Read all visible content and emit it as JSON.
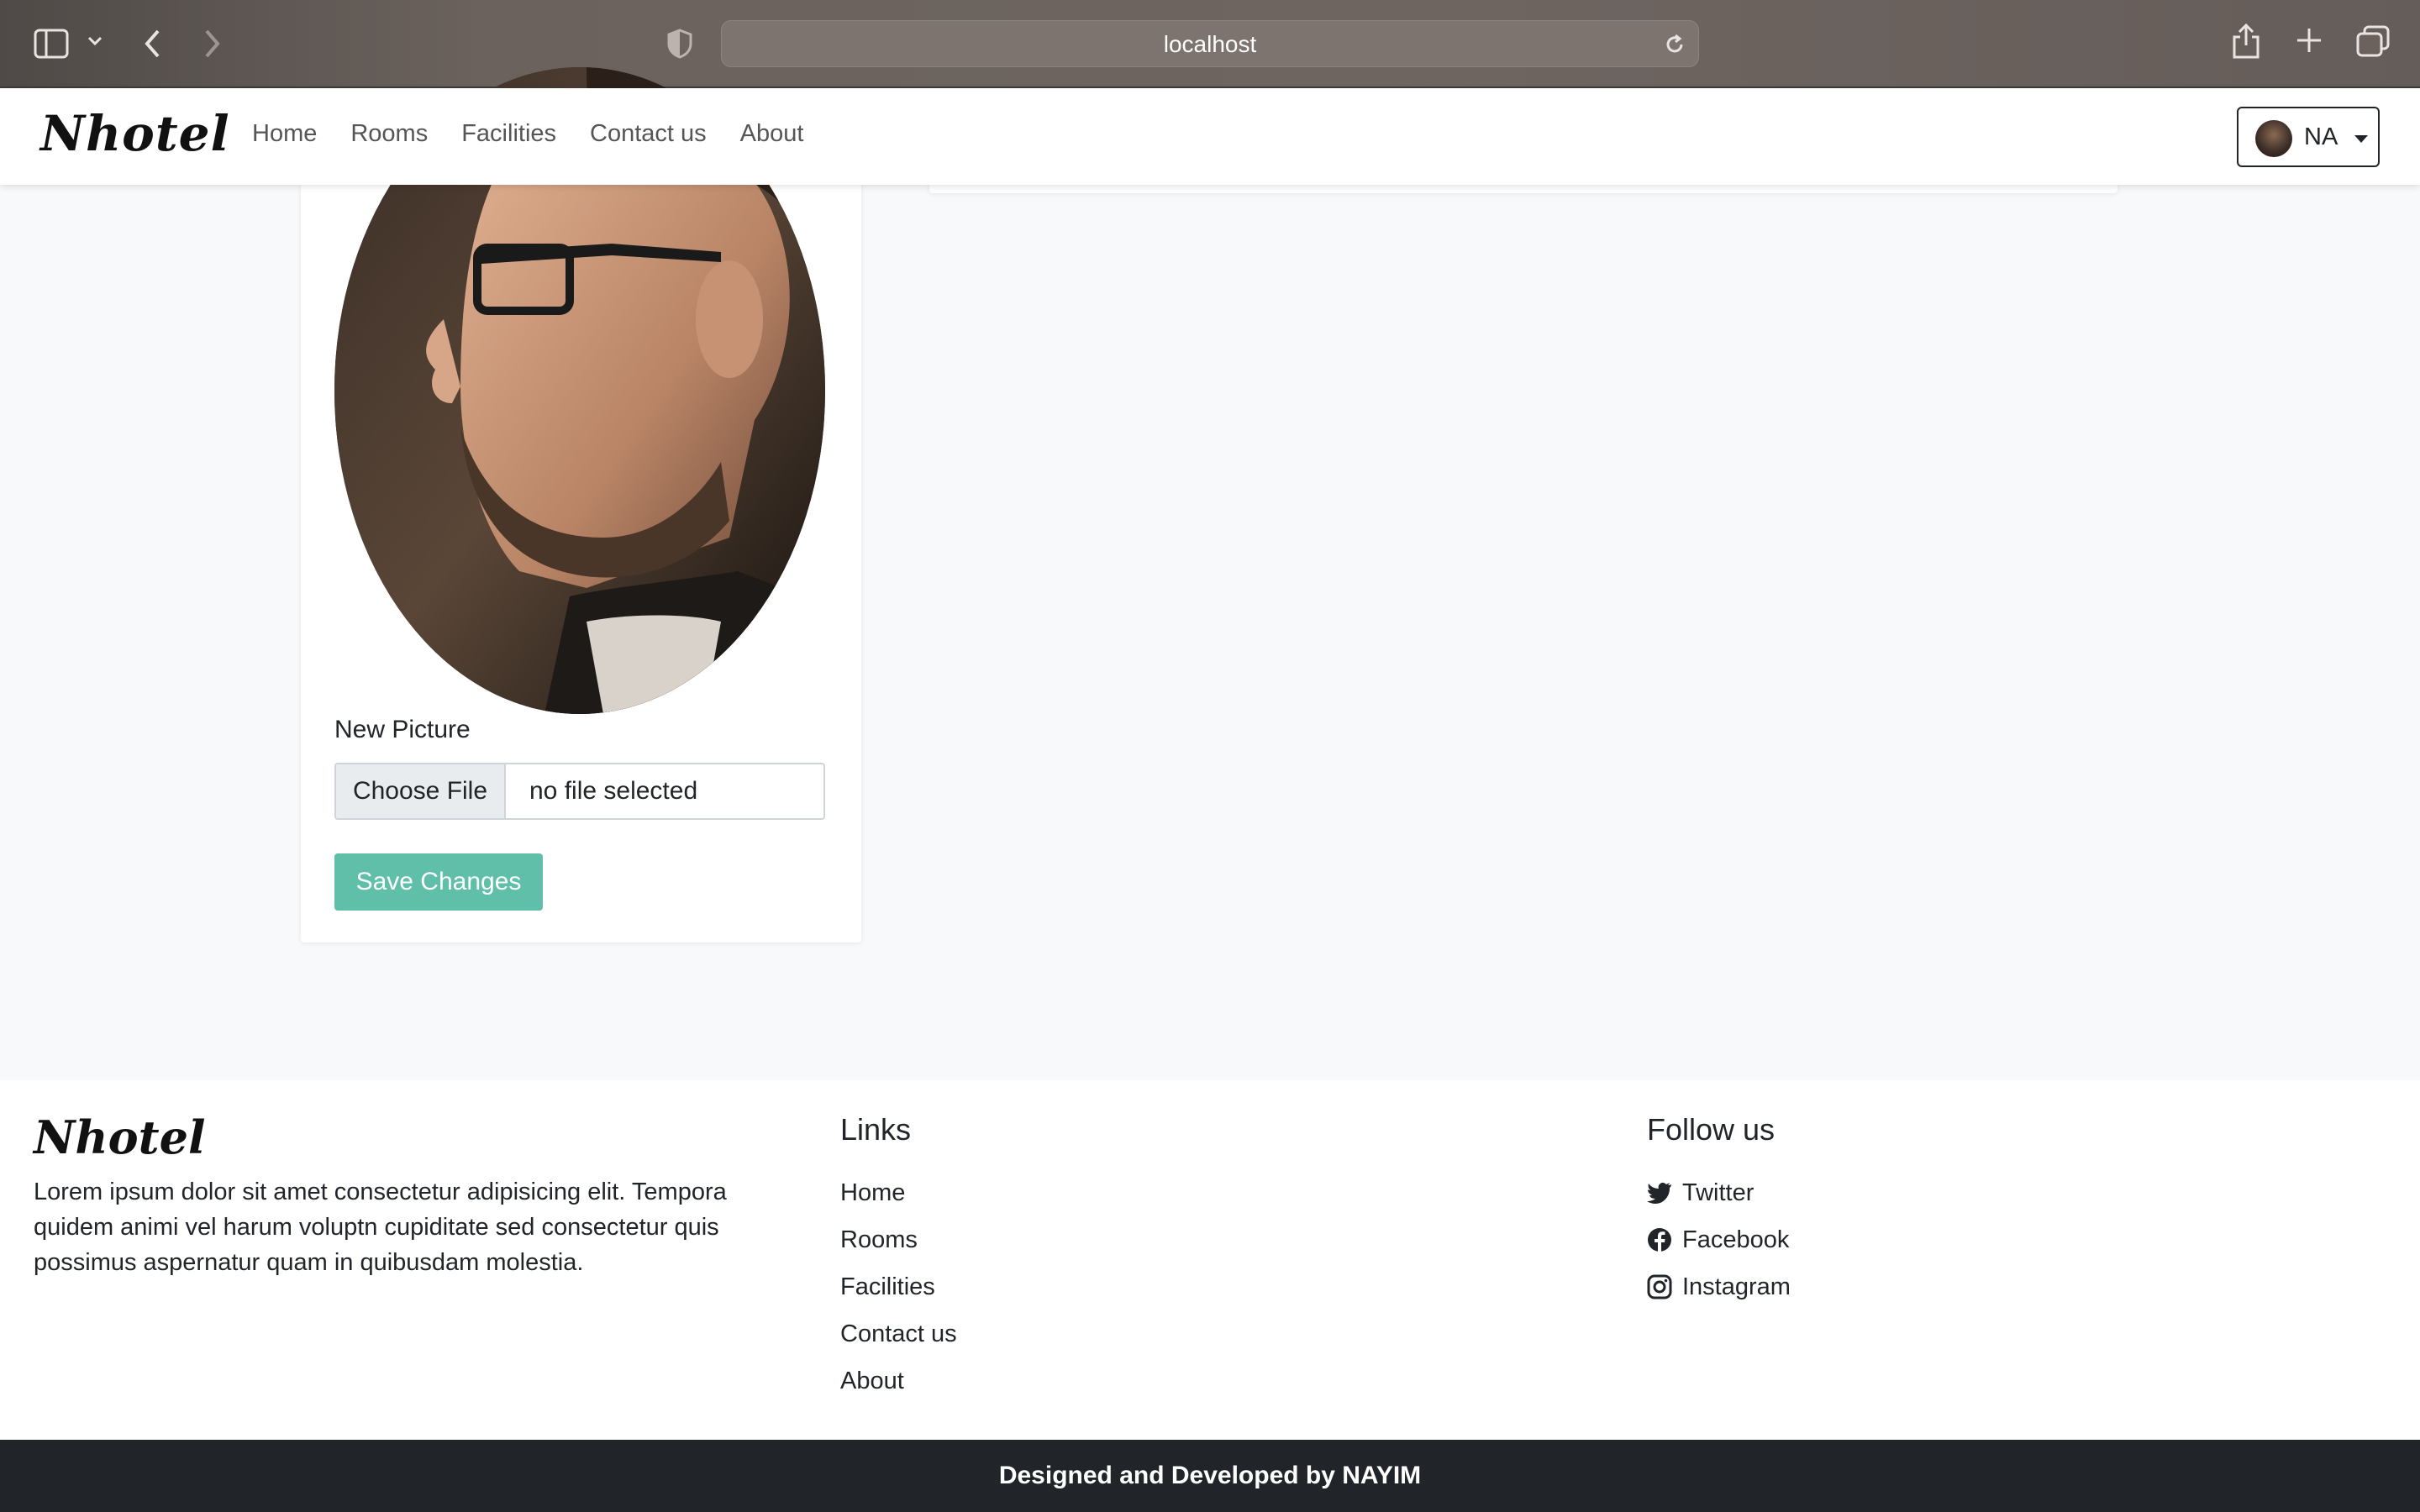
{
  "browser": {
    "url": "localhost",
    "icons": [
      "sidebar-icon",
      "chevron-down-icon",
      "back-icon",
      "forward-icon",
      "shield-icon",
      "reload-icon",
      "share-icon",
      "plus-icon",
      "tabs-icon"
    ]
  },
  "navbar": {
    "brand": "Nhotel",
    "links": [
      "Home",
      "Rooms",
      "Facilities",
      "Contact us",
      "About"
    ],
    "user_initials": "NA"
  },
  "profile_card": {
    "new_picture_label": "New Picture",
    "file_button": "Choose File",
    "file_status": "no file selected",
    "save_button": "Save Changes"
  },
  "footer": {
    "brand": "Nhotel",
    "description": "Lorem ipsum dolor sit amet consectetur adipisicing elit. Tempora quidem animi vel harum voluptn cupiditate sed consectetur quis possimus aspernatur quam in quibusdam molestia.",
    "links_title": "Links",
    "links": [
      "Home",
      "Rooms",
      "Facilities",
      "Contact us",
      "About"
    ],
    "follow_title": "Follow us",
    "social": [
      "Twitter",
      "Facebook",
      "Instagram"
    ],
    "credit": "Designed and Developed by NAYIM"
  },
  "colors": {
    "accent": "#5fbfa9",
    "footer_bar": "#212529"
  }
}
